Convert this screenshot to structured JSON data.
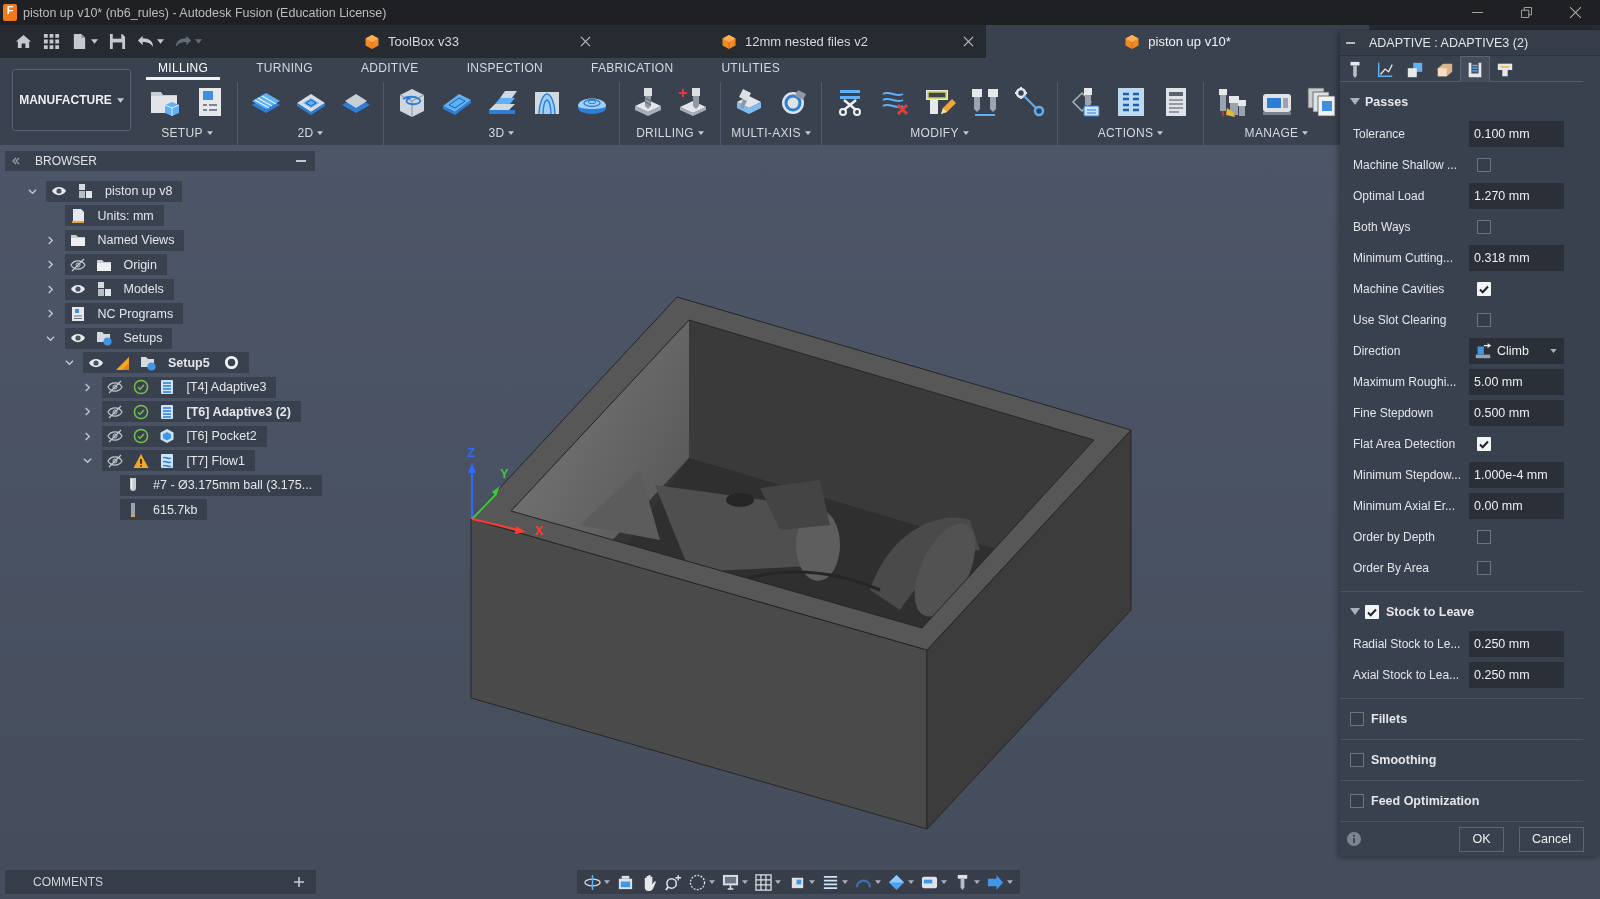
{
  "window": {
    "logo_text": "F",
    "title": "piston up v10* (nb6_rules) - Autodesk Fusion (Education License)"
  },
  "quick_access": [
    {
      "disabled": false
    },
    {
      "disabled": false
    },
    {
      "disabled": false
    },
    {
      "disabled": false
    },
    {
      "disabled": false
    },
    {
      "disabled": true
    }
  ],
  "document_tabs": [
    {
      "label": "ToolBox v33",
      "selected": false
    },
    {
      "label": "12mm nested files v2",
      "selected": false
    },
    {
      "label": "piston up v10*",
      "selected": true
    }
  ],
  "ribbon": {
    "workspace": "MANUFACTURE",
    "tabs": [
      {
        "label": "MILLING",
        "selected": true
      },
      {
        "label": "TURNING",
        "selected": false
      },
      {
        "label": "ADDITIVE",
        "selected": false
      },
      {
        "label": "INSPECTION",
        "selected": false
      },
      {
        "label": "FABRICATION",
        "selected": false
      },
      {
        "label": "UTILITIES",
        "selected": false
      }
    ],
    "groups": [
      {
        "label": "SETUP"
      },
      {
        "label": "2D"
      },
      {
        "label": "3D"
      },
      {
        "label": "DRILLING"
      },
      {
        "label": "MULTI-AXIS"
      },
      {
        "label": "MODIFY"
      },
      {
        "label": "ACTIONS"
      },
      {
        "label": "MANAGE"
      }
    ]
  },
  "browser": {
    "title": "BROWSER",
    "tree": [
      {
        "label": "piston up v8",
        "kind": "component",
        "visible": true,
        "expanded": true,
        "children": [
          {
            "label": "Units: mm",
            "kind": "units"
          },
          {
            "label": "Named Views",
            "kind": "folder",
            "expanded": false
          },
          {
            "label": "Origin",
            "kind": "folder",
            "visible": false,
            "expanded": false
          },
          {
            "label": "Models",
            "kind": "component",
            "visible": true,
            "expanded": false
          },
          {
            "label": "NC Programs",
            "kind": "nc-programs",
            "expanded": false
          },
          {
            "label": "Setups",
            "kind": "setups",
            "visible": true,
            "expanded": true,
            "children": [
              {
                "label": "Setup5",
                "kind": "setup",
                "visible": true,
                "expanded": true,
                "active": true,
                "children": [
                  {
                    "label": "[T4] Adaptive3",
                    "kind": "adaptive",
                    "visible": false,
                    "warning": false,
                    "expanded": false,
                    "editing": false
                  },
                  {
                    "label": "[T6] Adaptive3 (2)",
                    "kind": "adaptive",
                    "visible": false,
                    "warning": false,
                    "expanded": false,
                    "editing": true
                  },
                  {
                    "label": "[T6] Pocket2",
                    "kind": "pocket",
                    "visible": false,
                    "warning": false,
                    "expanded": false,
                    "editing": false
                  },
                  {
                    "label": "[T7] Flow1",
                    "kind": "flow",
                    "visible": false,
                    "warning": true,
                    "expanded": true,
                    "editing": false,
                    "children": [
                      {
                        "label": "#7 - Ø3.175mm ball (3.175...",
                        "kind": "tool"
                      },
                      {
                        "label": "615.7kb",
                        "kind": "file-size"
                      }
                    ]
                  }
                ]
              }
            ]
          }
        ]
      }
    ]
  },
  "viewport": {
    "axes": [
      {
        "label": "Z",
        "color": "#2f6bff"
      },
      {
        "label": "Y",
        "color": "#3cc83c"
      },
      {
        "label": "X",
        "color": "#ff3b30"
      }
    ]
  },
  "comments": {
    "title": "COMMENTS"
  },
  "operation_panel": {
    "title": "ADAPTIVE : ADAPTIVE3 (2)",
    "tabs": [
      {
        "selected": false
      },
      {
        "selected": false
      },
      {
        "selected": false
      },
      {
        "selected": false
      },
      {
        "selected": true
      },
      {
        "selected": false
      }
    ],
    "sections": [
      {
        "title": "Passes",
        "expanded": true,
        "rows": [
          {
            "kind": "field",
            "label": "Tolerance",
            "value": "0.100 mm"
          },
          {
            "kind": "checkbox",
            "label": "Machine Shallow ...",
            "checked": false
          },
          {
            "kind": "field",
            "label": "Optimal Load",
            "value": "1.270 mm"
          },
          {
            "kind": "checkbox",
            "label": "Both Ways",
            "checked": false
          },
          {
            "kind": "field",
            "label": "Minimum Cutting...",
            "value": "0.318 mm"
          },
          {
            "kind": "checkbox",
            "label": "Machine Cavities",
            "checked": true
          },
          {
            "kind": "checkbox",
            "label": "Use Slot Clearing",
            "checked": false
          },
          {
            "kind": "dropdown",
            "label": "Direction",
            "value": "Climb"
          },
          {
            "kind": "field",
            "label": "Maximum Roughi...",
            "value": "5.00 mm"
          },
          {
            "kind": "field",
            "label": "Fine Stepdown",
            "value": "0.500 mm"
          },
          {
            "kind": "checkbox",
            "label": "Flat Area Detection",
            "checked": true
          },
          {
            "kind": "field",
            "label": "Minimum Stepdow...",
            "value": "1.000e-4 mm"
          },
          {
            "kind": "field",
            "label": "Minimum Axial Er...",
            "value": "0.00 mm"
          },
          {
            "kind": "checkbox",
            "label": "Order by Depth",
            "checked": false
          },
          {
            "kind": "checkbox",
            "label": "Order By Area",
            "checked": false
          }
        ]
      },
      {
        "title": "Stock to Leave",
        "expanded": true,
        "checked": true,
        "rows": [
          {
            "kind": "field",
            "label": "Radial Stock to Le...",
            "value": "0.250 mm"
          },
          {
            "kind": "field",
            "label": "Axial Stock to Lea...",
            "value": "0.250 mm"
          }
        ]
      },
      {
        "title": "Fillets",
        "checked": false
      },
      {
        "title": "Smoothing",
        "checked": false
      },
      {
        "title": "Feed Optimization",
        "checked": false
      }
    ],
    "buttons": [
      {
        "label": "OK"
      },
      {
        "label": "Cancel"
      }
    ]
  }
}
